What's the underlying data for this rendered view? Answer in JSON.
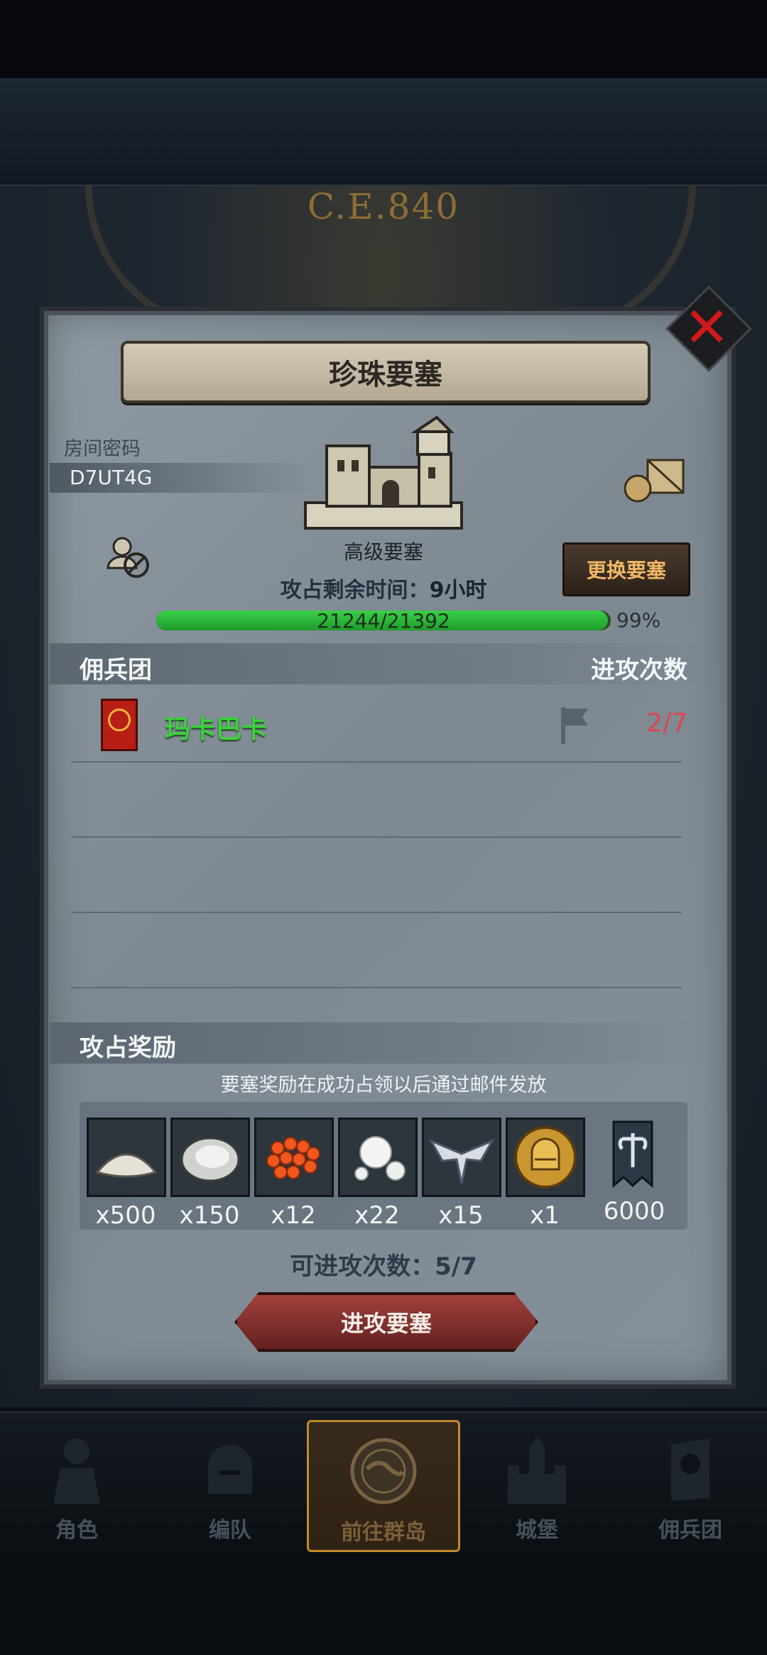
{
  "background": {
    "era_text": "C.E.840"
  },
  "dialog": {
    "title": "珍珠要塞",
    "room_label": "房间密码",
    "room_code": "D7UT4G",
    "fortress_type": "高级要塞",
    "change_button": "更换要塞",
    "time_label": "攻占剩余时间：",
    "time_value": "9小时",
    "hp_text": "21244/21392",
    "hp_percent": "99%",
    "hp_fraction": 0.993,
    "mercenary_section_title": "佣兵团",
    "attack_count_header": "进攻次数",
    "mercenaries": [
      {
        "name": "玛卡巴卡",
        "attacks": "2/7"
      }
    ],
    "reward_section_title": "攻占奖励",
    "reward_note": "要塞奖励在成功占领以后通过邮件发放",
    "rewards": [
      {
        "icon": "flour-pile-icon",
        "qty": "x500"
      },
      {
        "icon": "oyster-icon",
        "qty": "x150"
      },
      {
        "icon": "fish-roe-icon",
        "qty": "x12"
      },
      {
        "icon": "pearls-icon",
        "qty": "x22"
      },
      {
        "icon": "winged-emblem-icon",
        "qty": "x15"
      },
      {
        "icon": "gold-helmet-coin-icon",
        "qty": "x1"
      },
      {
        "icon": "axe-banner-icon",
        "qty": "6000"
      }
    ],
    "attempts_text": "可进攻次数：5/7",
    "attack_button": "进攻要塞",
    "close_icon": "close-icon"
  },
  "nav": {
    "items": [
      {
        "label": "角色",
        "icon": "knight-icon"
      },
      {
        "label": "编队",
        "icon": "helmet-icon"
      },
      {
        "label": "前往群岛",
        "icon": "compass-map-icon"
      },
      {
        "label": "城堡",
        "icon": "castle-icon"
      },
      {
        "label": "佣兵团",
        "icon": "mercenary-icon"
      }
    ],
    "active_index": 2
  },
  "colors": {
    "accent_green": "#3cd23c",
    "count_red": "#e0444d",
    "button_red": "#8b2e2b",
    "change_text": "#f1b766"
  }
}
